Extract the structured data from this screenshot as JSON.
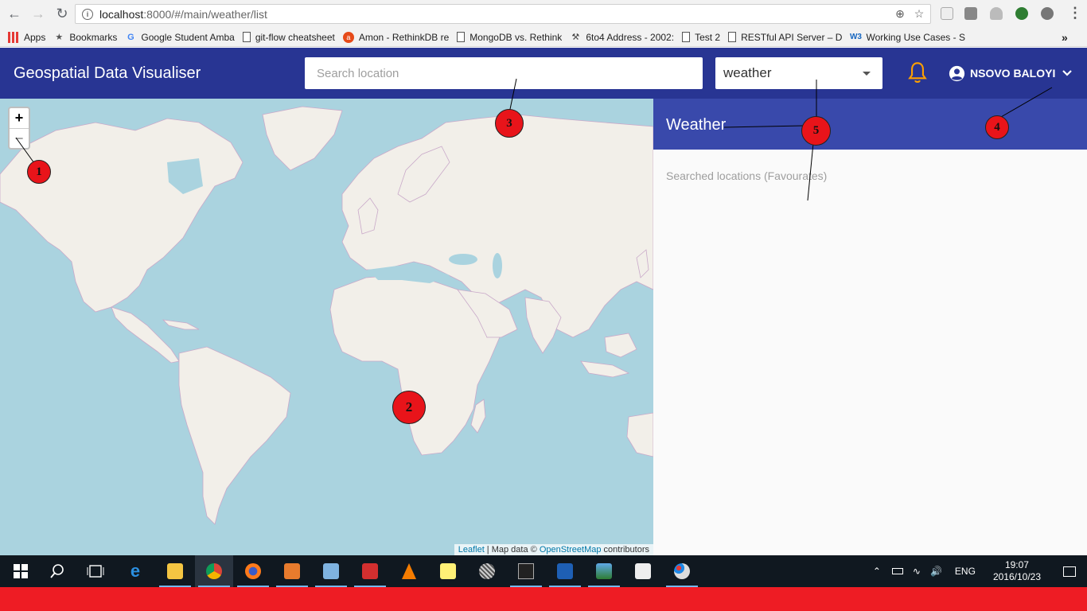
{
  "browser": {
    "url_host": "localhost",
    "url_path": ":8000/#/main/weather/list",
    "bookmarks": [
      {
        "label": "Apps",
        "icon": "apps-grid-icon"
      },
      {
        "label": "Bookmarks",
        "icon": "star-icon"
      },
      {
        "label": "Google Student Amba",
        "icon": "google-icon"
      },
      {
        "label": "git-flow cheatsheet",
        "icon": "page-icon"
      },
      {
        "label": "Amon - RethinkDB re",
        "icon": "amon-icon"
      },
      {
        "label": "MongoDB vs. Rethink",
        "icon": "page-icon"
      },
      {
        "label": "6to4 Address - 2002:",
        "icon": "tool-icon"
      },
      {
        "label": "Test 2",
        "icon": "page-icon"
      },
      {
        "label": "RESTful API Server – D",
        "icon": "page-icon"
      },
      {
        "label": "Working Use Cases - S",
        "icon": "w3-icon"
      }
    ],
    "more_label": "»"
  },
  "header": {
    "title": "Geospatial Data Visualiser",
    "search_placeholder": "Search location",
    "layer_value": "weather",
    "user_name": "NSOVO BALOYI"
  },
  "map": {
    "zoom_in": "+",
    "zoom_out": "−",
    "attribution_leaflet": "Leaflet",
    "attribution_sep": " | Map data © ",
    "attribution_osm": "OpenStreetMap",
    "attribution_tail": " contributors"
  },
  "panel": {
    "title": "Weather",
    "subtitle": "Searched locations (Favourates)"
  },
  "annotations": [
    "1",
    "2",
    "3",
    "4",
    "5"
  ],
  "taskbar": {
    "lang": "ENG",
    "time": "19:07",
    "date": "2016/10/23"
  },
  "colors": {
    "header": "#283593",
    "panel_header": "#3949ab",
    "water": "#aad3df",
    "land": "#f2efe9",
    "marker": "#e8141a",
    "bell": "#ffa000",
    "bottom_strip": "#ee1c24"
  }
}
